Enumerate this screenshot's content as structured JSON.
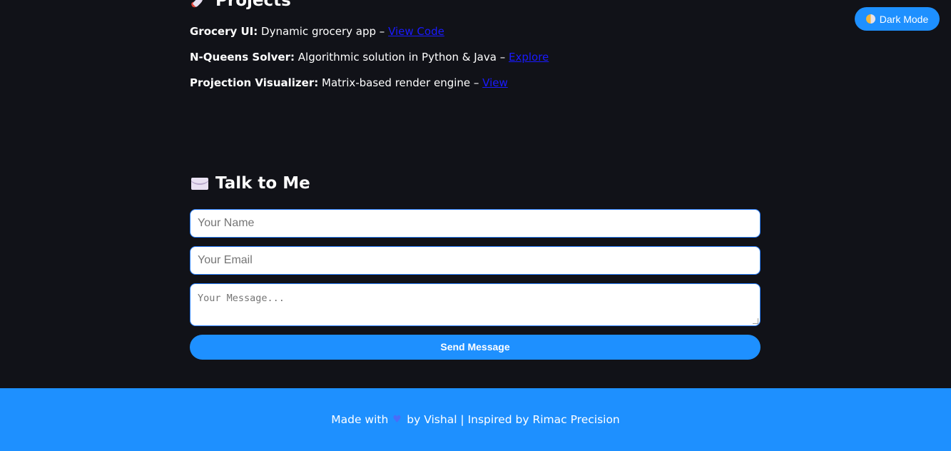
{
  "projects": {
    "heading": "Projects",
    "icon": "rocket-icon",
    "items": [
      {
        "name": "Grocery UI:",
        "description": "Dynamic grocery app –",
        "link": "View Code"
      },
      {
        "name": "N-Queens Solver:",
        "description": "Algorithmic solution in Python & Java –",
        "link": "Explore"
      },
      {
        "name": "Projection Visualizer:",
        "description": "Matrix-based render engine –",
        "link": "View"
      }
    ]
  },
  "contact": {
    "heading": "Talk to Me",
    "icon": "envelope-icon",
    "name_placeholder": "Your Name",
    "email_placeholder": "Your Email",
    "message_placeholder": "Your Message...",
    "send_label": "Send Message"
  },
  "theme_toggle": {
    "label": "Dark Mode",
    "icon": "half-moon-icon"
  },
  "footer": {
    "made_with": "Made with",
    "heart_icon": "heart-icon",
    "credit": "by Vishal | Inspired by Rimac Precision"
  },
  "colors": {
    "background": "#111218",
    "accent": "#1e90ff",
    "link": "#1a1aff"
  }
}
